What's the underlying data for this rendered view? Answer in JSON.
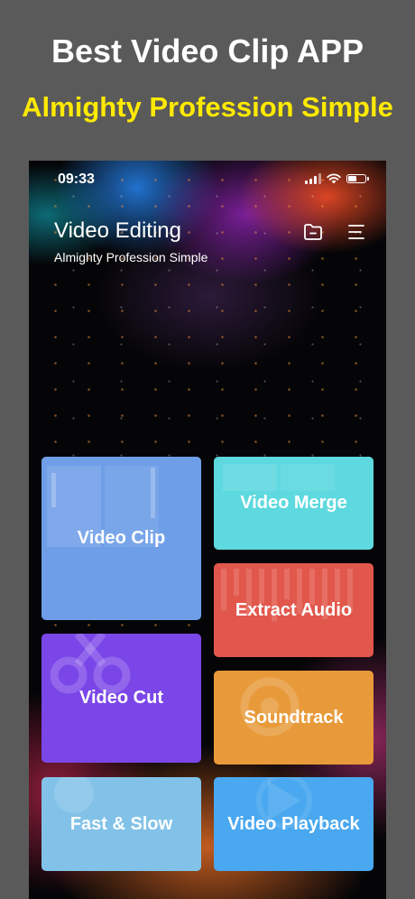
{
  "promo": {
    "headline": "Best Video Clip APP",
    "subheadline": "Almighty Profession Simple"
  },
  "status_bar": {
    "time": "09:33",
    "icons": [
      "signal-icon",
      "wifi-icon",
      "battery-icon"
    ],
    "battery_level": 0.45
  },
  "header": {
    "title": "Video Editing",
    "subtitle": "Almighty Profession Simple",
    "actions": [
      "folder-icon",
      "menu-icon"
    ]
  },
  "tiles": [
    {
      "label": "Video Clip",
      "color": "#6e9ee8"
    },
    {
      "label": "Video Merge",
      "color": "#5ed9df"
    },
    {
      "label": "Extract Audio",
      "color": "#e2574b"
    },
    {
      "label": "Video Cut",
      "color": "#7a46e8"
    },
    {
      "label": "Soundtrack",
      "color": "#e89a3a"
    },
    {
      "label": "Fast & Slow",
      "color": "#82c2e8"
    },
    {
      "label": "Video Playback",
      "color": "#49a8f0"
    }
  ]
}
